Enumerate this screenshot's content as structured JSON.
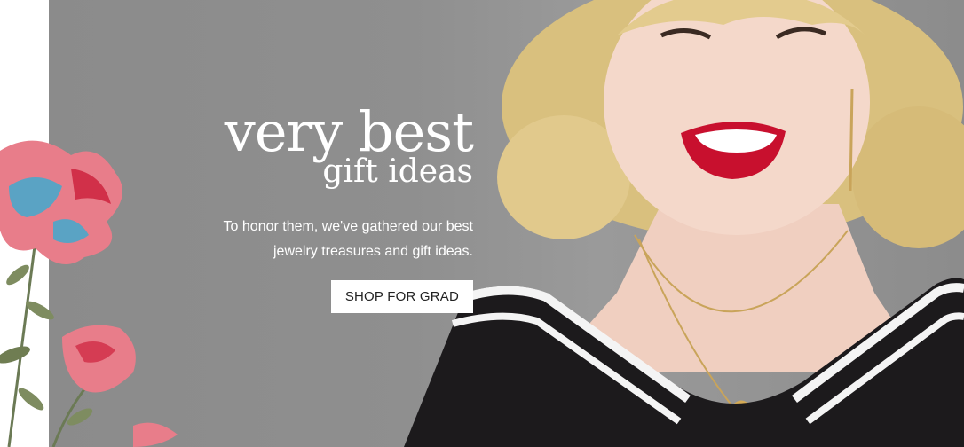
{
  "hero": {
    "headline_line1": "very best",
    "headline_line2": "gift ideas",
    "subtext_line1": "To honor them, we've gathered our best",
    "subtext_line2": "jewelry treasures and gift ideas.",
    "cta_label": "SHOP FOR GRAD"
  },
  "colors": {
    "background": "#8f8f8f",
    "text": "#ffffff",
    "button_bg": "#ffffff",
    "lipstick": "#c8102e"
  },
  "icons": {
    "floral": "floral-illustration",
    "portrait": "model-photo"
  }
}
